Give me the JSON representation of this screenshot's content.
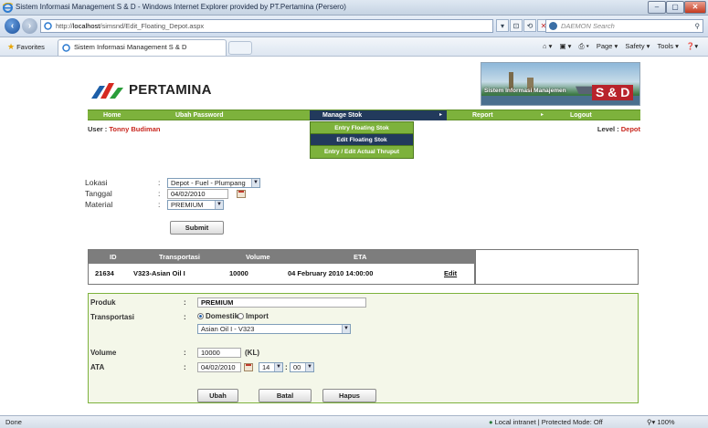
{
  "window": {
    "title": "Sistem Informasi Management S & D - Windows Internet Explorer provided by PT.Pertamina (Persero)",
    "controls": {
      "minimize": "–",
      "maximize": "▢",
      "close": "✕"
    }
  },
  "addressbar": {
    "url_prefix": "http://",
    "url_host": "localhost",
    "url_path": "/simsnd/Edit_Floating_Depot.aspx",
    "search_placeholder": "DAEMON Search",
    "search_icon": "magnifier-icon"
  },
  "favorites_bar": {
    "favorites_label": "Favorites",
    "tab_title": "Sistem Informasi Management S & D",
    "commands": [
      "Page ▾",
      "Safety ▾",
      "Tools ▾",
      "❓▾"
    ]
  },
  "header": {
    "logo_text": "PERTAMINA",
    "banner_text": "Sistem Informasi Manajemen",
    "banner_badge": "S & D"
  },
  "menu": {
    "items": [
      {
        "label": "Home"
      },
      {
        "label": "Ubah Password"
      },
      {
        "label": "Manage Stok"
      },
      {
        "label": "Report"
      },
      {
        "label": "Logout"
      }
    ],
    "dropdown": [
      {
        "label": "Entry Floating Stok"
      },
      {
        "label": "Edit Floating Stok"
      },
      {
        "label": "Entry / Edit Actual Thruput"
      }
    ]
  },
  "user": {
    "prefix": "User : ",
    "name": "Tonny Budiman"
  },
  "level": {
    "prefix": "Level : ",
    "value": "Depot"
  },
  "filter": {
    "lokasi_label": "Lokasi",
    "lokasi_value": "Depot - Fuel - Plumpang",
    "tanggal_label": "Tanggal",
    "tanggal_value": "04/02/2010",
    "material_label": "Material",
    "material_value": "PREMIUM",
    "submit_label": "Submit",
    "colon": ":"
  },
  "grid": {
    "headers": [
      "ID",
      "Transportasi",
      "Volume",
      "ETA"
    ],
    "rows": [
      {
        "id": "21634",
        "transportasi": "V323-Asian Oil I",
        "volume": "10000",
        "eta": "04 February 2010 14:00:00",
        "action": "Edit"
      }
    ]
  },
  "form": {
    "produk_label": "Produk",
    "produk_value": "PREMIUM",
    "transportasi_label": "Transportasi",
    "radio_domestik": "Domestik",
    "radio_import": "Import",
    "transportasi_value": "Asian Oil I - V323",
    "volume_label": "Volume",
    "volume_value": "10000",
    "volume_unit": "(KL)",
    "ata_label": "ATA",
    "ata_date": "04/02/2010",
    "ata_hour": "14",
    "ata_minute": "00",
    "colon": ":",
    "buttons": {
      "ubah": "Ubah",
      "batal": "Batal",
      "hapus": "Hapus"
    }
  },
  "statusbar": {
    "left": "Done",
    "zone": "Local intranet | Protected Mode: Off",
    "zoom": "100%"
  }
}
